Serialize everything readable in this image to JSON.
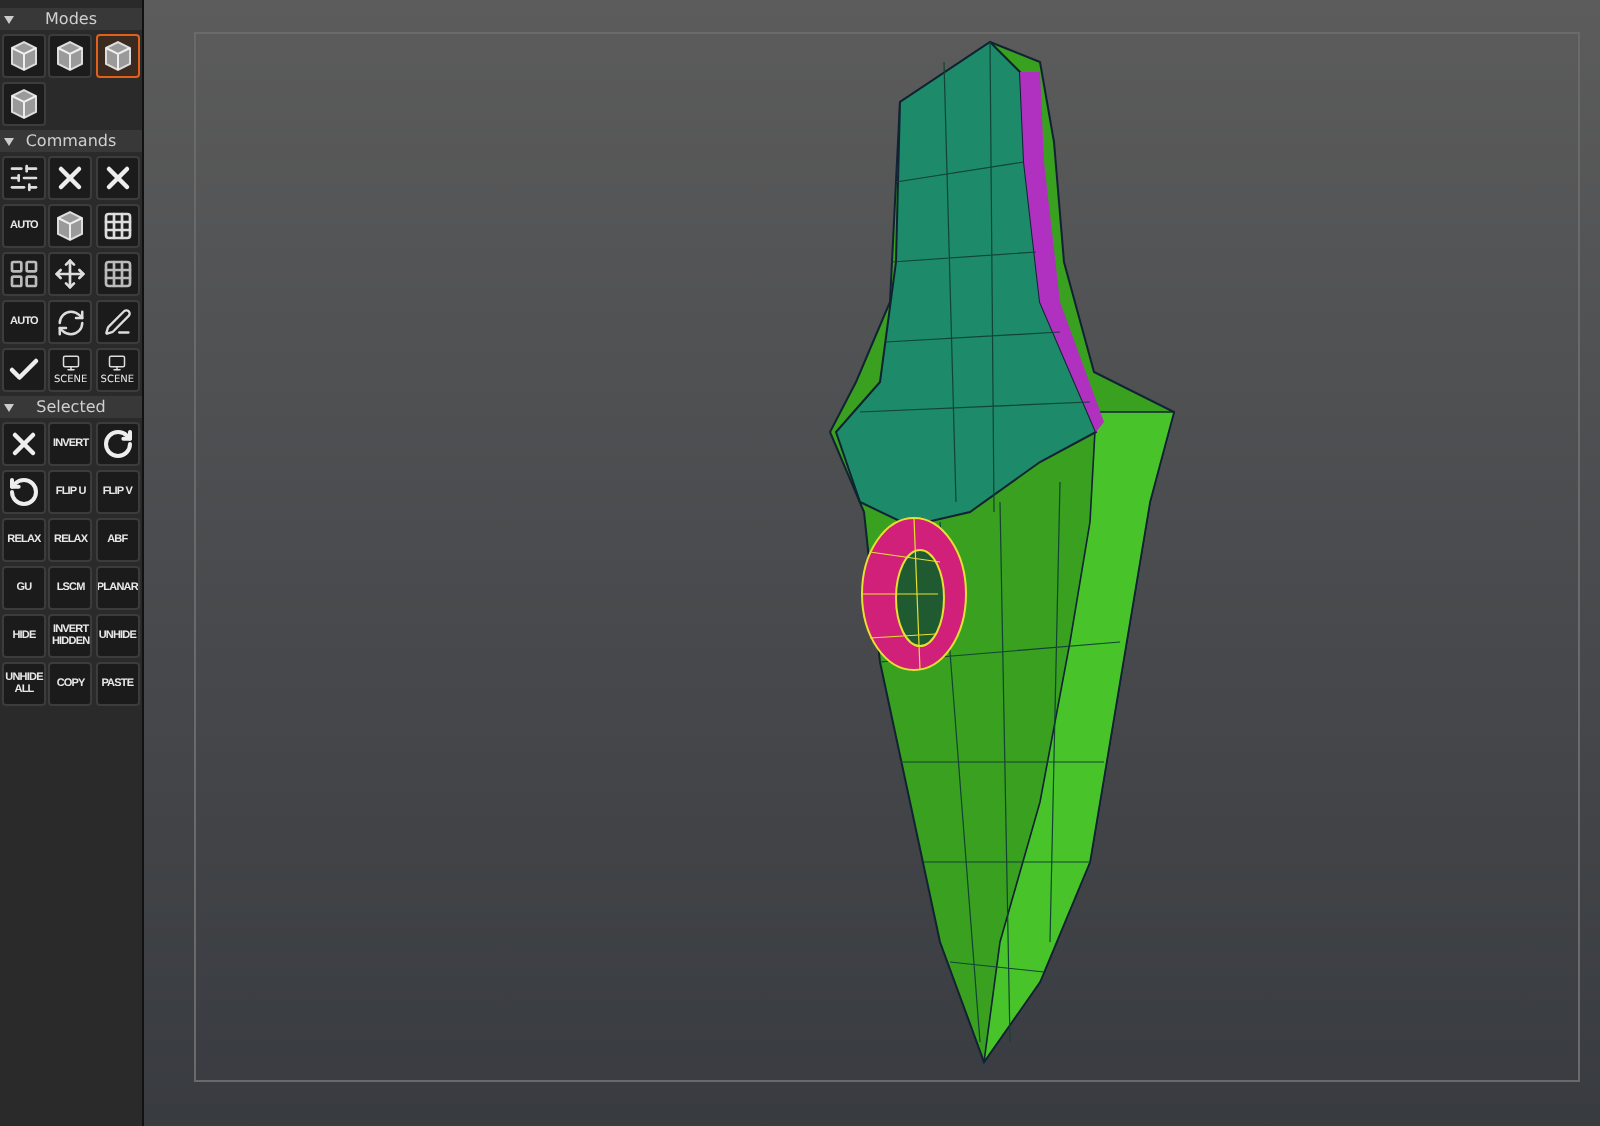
{
  "panel": {
    "sections": [
      {
        "title": "Modes",
        "expanded": true,
        "buttons": [
          {
            "kind": "icon",
            "selected": false
          },
          {
            "kind": "icon",
            "selected": false
          },
          {
            "kind": "icon",
            "selected": true
          },
          {
            "kind": "icon",
            "selected": false
          }
        ]
      },
      {
        "title": "Commands",
        "expanded": true,
        "buttons": [
          {
            "kind": "icon"
          },
          {
            "kind": "icon"
          },
          {
            "kind": "icon"
          },
          {
            "kind": "label",
            "label": "AUTO"
          },
          {
            "kind": "icon"
          },
          {
            "kind": "icon"
          },
          {
            "kind": "icon"
          },
          {
            "kind": "icon"
          },
          {
            "kind": "icon"
          },
          {
            "kind": "label",
            "label": "AUTO"
          },
          {
            "kind": "icon"
          },
          {
            "kind": "icon"
          },
          {
            "kind": "icon"
          },
          {
            "kind": "icon-label",
            "label": "SCENE"
          },
          {
            "kind": "icon-label",
            "label": "SCENE"
          }
        ]
      },
      {
        "title": "Selected",
        "expanded": true,
        "buttons": [
          {
            "kind": "icon"
          },
          {
            "kind": "label",
            "label": "INVERT"
          },
          {
            "kind": "icon"
          },
          {
            "kind": "icon"
          },
          {
            "kind": "label",
            "label": "FLIP U"
          },
          {
            "kind": "label",
            "label": "FLIP V"
          },
          {
            "kind": "label",
            "label": "RELAX"
          },
          {
            "kind": "label",
            "label": "RELAX"
          },
          {
            "kind": "label",
            "label": "ABF"
          },
          {
            "kind": "label",
            "label": "GU"
          },
          {
            "kind": "label",
            "label": "LSCM"
          },
          {
            "kind": "label",
            "label": "PLANAR"
          },
          {
            "kind": "label",
            "label": "HIDE"
          },
          {
            "kind": "label",
            "label": "INVERT HIDDEN"
          },
          {
            "kind": "label",
            "label": "UNHIDE"
          },
          {
            "kind": "label",
            "label": "UNHIDE ALL"
          },
          {
            "kind": "label",
            "label": "COPY"
          },
          {
            "kind": "label",
            "label": "PASTE"
          }
        ]
      }
    ]
  }
}
